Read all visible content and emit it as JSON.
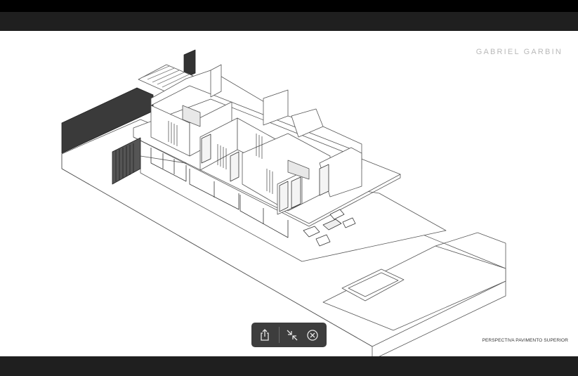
{
  "viewer": {
    "brand": "GABRIEL GARBIN",
    "caption": "PERSPECTIVA PAVIMENTO SUPERIOR"
  },
  "toolbar": {
    "share_icon": "share-icon",
    "collapse_icon": "collapse-arrows-icon",
    "close_icon": "close-circle-icon"
  },
  "colors": {
    "bars": "#000000",
    "strip": "#1f1f1f",
    "toolbar_bg": "#3d3d3d",
    "brand_text": "#b9b9b9"
  }
}
